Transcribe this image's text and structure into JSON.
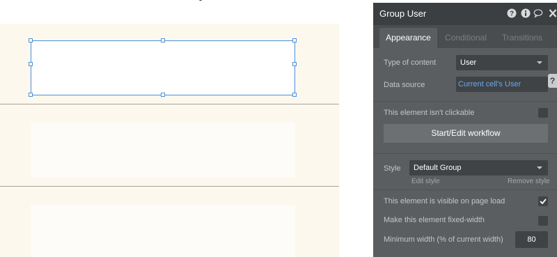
{
  "panel": {
    "title": "Group User",
    "tabs": [
      {
        "label": "Appearance"
      },
      {
        "label": "Conditional"
      },
      {
        "label": "Transitions"
      }
    ],
    "type_of_content": {
      "label": "Type of content",
      "value": "User"
    },
    "data_source": {
      "label": "Data source",
      "value": "Current cell's User"
    },
    "not_clickable": {
      "label": "This element isn't clickable",
      "checked": false
    },
    "workflow_button": "Start/Edit workflow",
    "style": {
      "label": "Style",
      "value": "Default Group",
      "edit_link": "Edit style",
      "remove_link": "Remove style"
    },
    "visible_on_load": {
      "label": "This element is visible on page load",
      "checked": true
    },
    "fixed_width": {
      "label": "Make this element fixed-width",
      "checked": false
    },
    "min_width": {
      "label": "Minimum width (% of current width)",
      "value": "80"
    },
    "help_tab": "?"
  },
  "header_icons": [
    "help-circle-icon",
    "info-icon",
    "comment-icon",
    "close-icon"
  ],
  "colors": {
    "canvas_bg": "#fdf8ed",
    "selection": "#4a90d9",
    "panel_bg": "#5b5e61",
    "panel_header": "#3c3f42",
    "link": "#6aa8e8"
  }
}
